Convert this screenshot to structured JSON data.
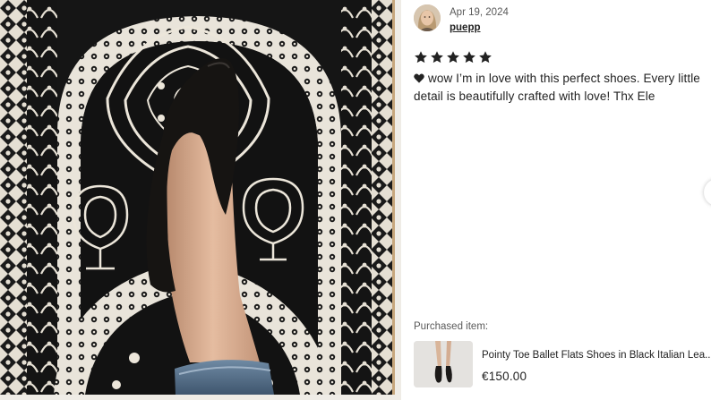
{
  "review": {
    "date": "Apr 19, 2024",
    "reviewer_name": "puepp",
    "rating": 5,
    "rating_max": 5,
    "text": "wow I’m in love with this perfect shoes. Every little detail is beautifully crafted with love! Thx Ele"
  },
  "purchased": {
    "label": "Purchased item:",
    "title": "Pointy Toe Ballet Flats Shoes in Black Italian Lea..",
    "price": "€150.00"
  },
  "icons": {
    "star": "star-icon",
    "heart": "black-heart-icon",
    "next": "chevron-right-icon"
  },
  "colors": {
    "text": "#222222",
    "muted": "#595959",
    "rug_dark": "#141414",
    "rug_light": "#e9e4da"
  }
}
